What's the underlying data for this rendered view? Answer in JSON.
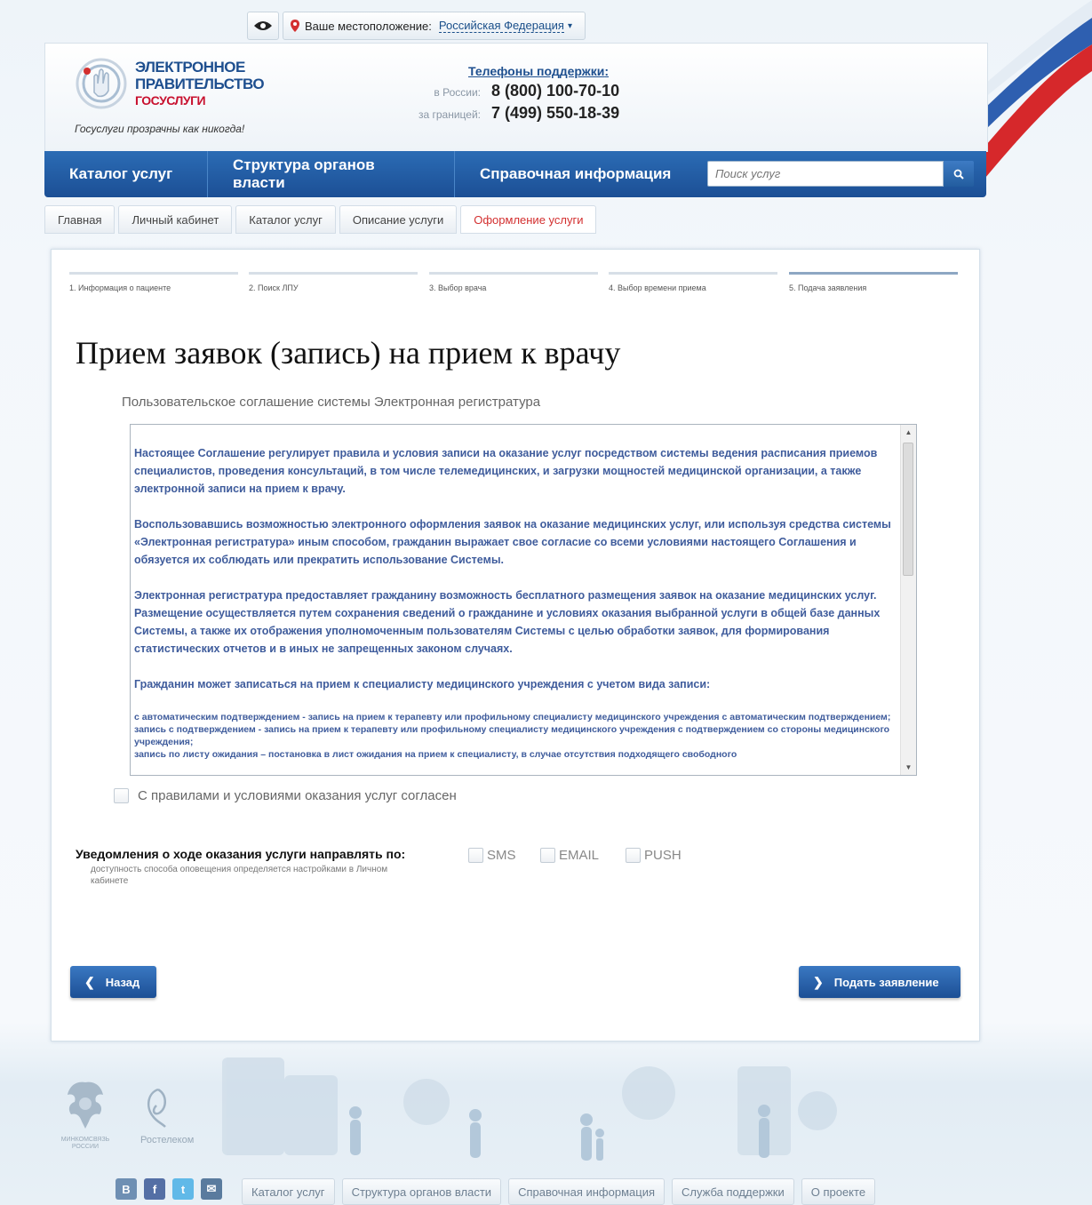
{
  "location": {
    "label": "Ваше местоположение:",
    "value": "Российская Федерация"
  },
  "header": {
    "logo_line1": "ЭЛЕКТРОННОЕ",
    "logo_line2": "ПРАВИТЕЛЬСТВО",
    "logo_line3": "ГОСУСЛУГИ",
    "slogan": "Госуслуги прозрачны как никогда!",
    "phones_title": "Телефоны поддержки",
    "phones": [
      {
        "label": "в России:",
        "value": "8 (800) 100-70-10"
      },
      {
        "label": "за границей:",
        "value": "7 (499) 550-18-39"
      }
    ]
  },
  "nav": {
    "items": [
      "Каталог услуг",
      "Структура органов власти",
      "Справочная информация"
    ],
    "search_placeholder": "Поиск услуг"
  },
  "breadcrumbs": [
    "Главная",
    "Личный кабинет",
    "Каталог услуг",
    "Описание услуги",
    "Оформление услуги"
  ],
  "steps": [
    "1. Информация о пациенте",
    "2. Поиск ЛПУ",
    "3. Выбор врача",
    "4. Выбор времени приема",
    "5. Подача заявления"
  ],
  "page": {
    "title": "Прием заявок (запись) на прием к врачу",
    "subtitle": "Пользовательское соглашение системы Электронная регистратура"
  },
  "agreement": {
    "paragraphs": [
      "Настоящее Соглашение регулирует правила и условия записи на оказание услуг посредством системы ведения расписания приемов специалистов, проведения консультаций, в том числе телемедицинских, и загрузки мощностей медицинской организации, а также электронной записи на прием к врачу.",
      "Воспользовавшись возможностью электронного оформления заявок на оказание медицинских услуг, или используя средства системы «Электронная регистратура» иным способом, гражданин выражает свое согласие со всеми условиями настоящего Соглашения и обязуется их соблюдать или прекратить использование Системы.",
      "Электронная регистратура предоставляет гражданину возможность бесплатного размещения заявок на оказание медицинских услуг. Размещение осуществляется путем сохранения сведений о гражданине и условиях оказания выбранной услуги в общей базе данных Системы, а также их отображения уполномоченным пользователям Системы с целью обработки заявок, для формирования статистических отчетов и в иных не запрещенных законом случаях.",
      "Гражданин может записаться на прием к специалисту медицинского учреждения с учетом вида записи:"
    ],
    "list": [
      "с автоматическим подтверждением - запись на прием к терапевту или профильному специалисту медицинского учреждения с автоматическим подтверждением;",
      "запись с подтверждением - запись на прием к терапевту или профильному специалисту медицинского учреждения с подтверждением со стороны медицинского учреждения;",
      "запись по листу ожидания – постановка в лист ожидания на прием к специалисту, в случае отсутствия подходящего свободного"
    ]
  },
  "consent_label": "С правилами и условиями оказания услуг согласен",
  "notify": {
    "label": "Уведомления о ходе оказания услуги направлять по:",
    "hint": "доступность способа оповещения определяется настройками в Личном кабинете",
    "options": [
      "SMS",
      "EMAIL",
      "PUSH"
    ]
  },
  "buttons": {
    "back": "Назад",
    "submit": "Подать заявление"
  },
  "footer": {
    "partner1": "МИНКОМСВЯЗЬ РОССИИ",
    "partner2": "Ростелеком",
    "social": [
      "В",
      "f",
      "t",
      "✉"
    ],
    "links": [
      "Каталог услуг",
      "Структура органов власти",
      "Справочная информация",
      "Служба поддержки",
      "О проекте"
    ]
  },
  "colors": {
    "nav_blue": "#1c4f95",
    "active_crumb": "#d32f2f",
    "agreement_text": "#3f5c9c"
  }
}
